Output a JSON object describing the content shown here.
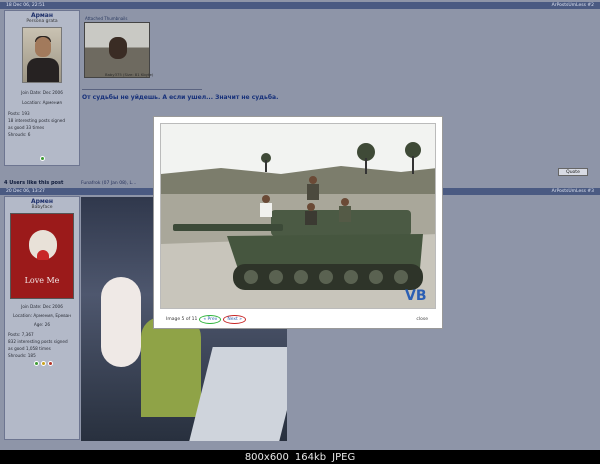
{
  "posts": [
    {
      "date": "18 Dec 06, 22:51",
      "number": "#2",
      "user_link": "ArPostsUmLess",
      "username": "Арман",
      "usertitle": "Persona grata",
      "join_date": "Join Date: Dec 2006",
      "location": "Location: Армения",
      "stats": [
        "Posts: 193",
        "18 interesting posts signed",
        "as good 33 times",
        "Shrouds: 6"
      ],
      "attached_label": "Attached Thumbnails",
      "thumb_caption": "Baby375 (Size: 81 Kbyte)",
      "message": "От судьбы не уйдешь. А если ушел... Значит не судьба.",
      "quote_label": "Quote",
      "likes_title": "4 Users like this post",
      "likes_list": "Funafrok (07 Jan 08), L..."
    },
    {
      "date": "20 Dec 06, 13:27",
      "number": "#3",
      "user_link": "ArPostsUmLess",
      "username": "Армен",
      "usertitle": "Babyface",
      "avatar_text": "Love Me",
      "join_date": "Join Date: Dec 2006",
      "location": "Location: Армения, Ереван",
      "age": "Age: 26",
      "stats": [
        "Posts: 7,367",
        "832 interesting posts signed",
        "as good 1,058 times",
        "Shrouds: 185"
      ]
    }
  ],
  "lightbox": {
    "counter": "Image 5 of 11",
    "prev_label": "« Prev",
    "next_label": "Next »",
    "close_label": "close",
    "watermark": "VB"
  },
  "viewer_status": {
    "dimensions": "800x600",
    "filesize": "164kb",
    "format": "JPEG"
  },
  "colors": {
    "prev_highlight": "#2fb43b",
    "next_highlight": "#c72727",
    "post_header": "#4a5a82"
  }
}
